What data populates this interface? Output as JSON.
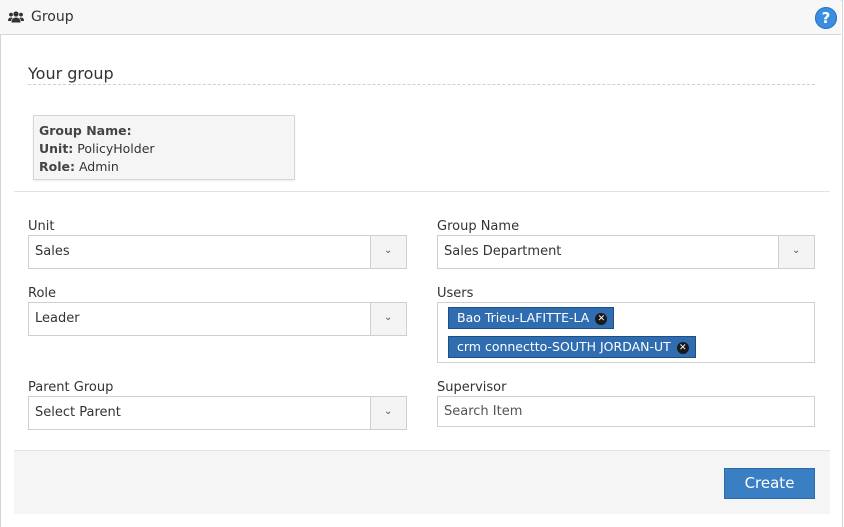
{
  "window": {
    "title": "Group",
    "title_icon": "users-icon",
    "help_icon": "help-icon"
  },
  "section": {
    "title": "Your group"
  },
  "info": {
    "group_name_label": "Group Name:",
    "unit_label": "Unit:",
    "unit_value": "PolicyHolder",
    "role_label": "Role:",
    "role_value": "Admin"
  },
  "form": {
    "unit": {
      "label": "Unit",
      "value": "Sales"
    },
    "group_name": {
      "label": "Group Name",
      "value": "Sales Department"
    },
    "role": {
      "label": "Role",
      "value": "Leader"
    },
    "users": {
      "label": "Users",
      "tags": [
        "Bao Trieu-LAFITTE-LA",
        "crm connectto-SOUTH JORDAN-UT"
      ]
    },
    "parent_group": {
      "label": "Parent Group",
      "value": "Select Parent"
    },
    "supervisor": {
      "label": "Supervisor",
      "placeholder": "Search Item"
    }
  },
  "actions": {
    "create_label": "Create"
  },
  "colors": {
    "primary": "#3a7fc4",
    "tag_bg": "#2f6db0",
    "help": "#3a8de0"
  }
}
